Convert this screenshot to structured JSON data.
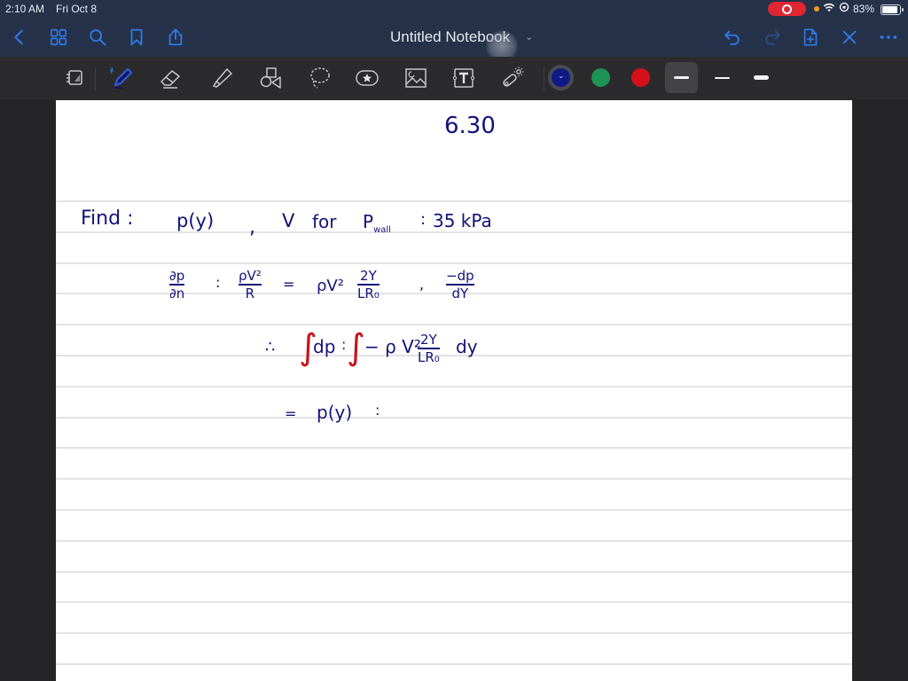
{
  "status_bar": {
    "time": "2:10 AM",
    "date": "Fri Oct 8",
    "battery_percent": "83%",
    "recording": true,
    "icons": [
      "screen-recording-icon",
      "orange-dot-indicator",
      "wifi-icon",
      "orientation-lock-icon",
      "battery-icon"
    ]
  },
  "nav": {
    "title": "Untitled Notebook",
    "left_buttons": [
      "back-icon",
      "thumbnails-icon",
      "search-icon",
      "bookmark-icon",
      "share-icon"
    ],
    "right_buttons": [
      "undo-icon",
      "redo-icon",
      "add-page-icon",
      "close-icon",
      "more-icon"
    ]
  },
  "toolbar": {
    "tools": [
      "read-mode",
      "pen",
      "eraser",
      "highlighter",
      "shapes",
      "lasso",
      "elements",
      "image",
      "text",
      "laser-pointer"
    ],
    "selected_tool": "pen",
    "colors": [
      {
        "name": "navy",
        "hex": "#0f1a86",
        "selected": true
      },
      {
        "name": "green",
        "hex": "#1e9356",
        "selected": false
      },
      {
        "name": "red",
        "hex": "#d5101a",
        "selected": false
      }
    ],
    "stroke_widths": [
      {
        "name": "medium",
        "selected": true
      },
      {
        "name": "thin",
        "selected": false
      },
      {
        "name": "thick",
        "selected": false
      }
    ]
  },
  "colors": {
    "ink": "#12127a",
    "ink_red": "#c4161c",
    "accent": "#2e7be8",
    "chrome": "#26324a",
    "toolbar": "#2b2b2e"
  },
  "page": {
    "heading": "6.30",
    "line1": {
      "find": "Find :",
      "p_y": "p(y)",
      "comma": ",",
      "v": "V",
      "for": "for",
      "p": "P",
      "wall": "wall",
      "eq": ":",
      "value": "35 kPa"
    },
    "line2": {
      "dp": "∂p",
      "dn": "∂n",
      "eq1": ":",
      "rhov2": "ρV²",
      "R": "R",
      "eq2": "=",
      "rhov2b": "ρV²",
      "two_y": "2Y",
      "lr0": "LR₀",
      "eq3": ",",
      "neg_dp": "−dp",
      "dy": "dY"
    },
    "line3": {
      "therefore": "∴",
      "integral1": "∫",
      "dp": "dp",
      "eq": ":",
      "integral2": "∫",
      "expr": "− ρ V²",
      "two_y": "2Y",
      "lr0": "LR₀",
      "dy": "dy"
    },
    "line4": {
      "eq": "=",
      "p_y": "p(y)",
      "tail": ":"
    }
  }
}
